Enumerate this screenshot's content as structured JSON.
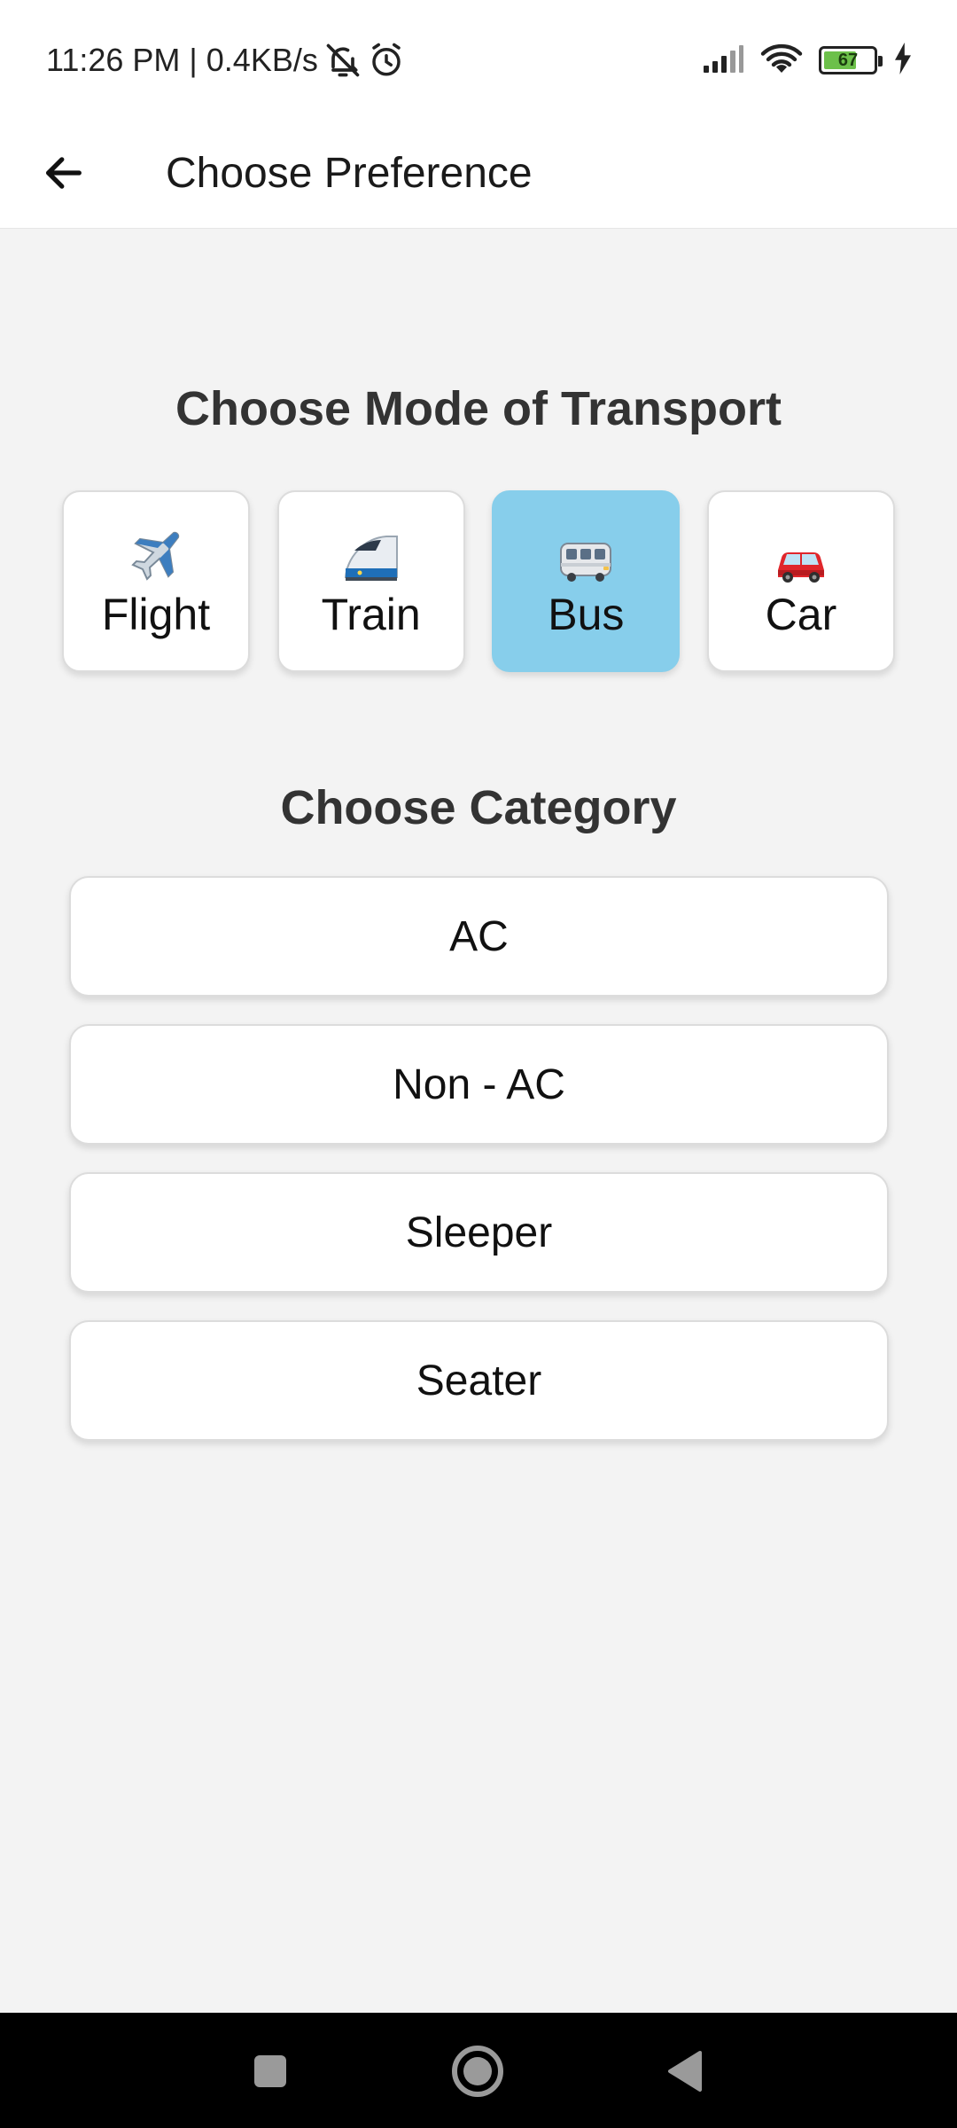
{
  "status_bar": {
    "time_network": "11:26 PM | 0.4KB/s",
    "battery_level": "67",
    "battery_fraction": 0.67,
    "icons": [
      "mute-icon",
      "alarm-icon",
      "signal-icon",
      "wifi-icon",
      "battery-icon",
      "charging-icon"
    ]
  },
  "app_bar": {
    "back_icon": "arrow-left-icon",
    "title": "Choose Preference"
  },
  "transport": {
    "heading": "Choose Mode of Transport",
    "selected": "Bus",
    "selected_color": "#87ceeb",
    "modes": [
      {
        "label": "Flight",
        "icon": "airplane-icon"
      },
      {
        "label": "Train",
        "icon": "bullet-train-icon"
      },
      {
        "label": "Bus",
        "icon": "bus-icon"
      },
      {
        "label": "Car",
        "icon": "car-icon"
      }
    ]
  },
  "category": {
    "heading": "Choose Category",
    "options": [
      "AC",
      "Non - AC",
      "Sleeper",
      "Seater"
    ]
  },
  "nav_bar": {
    "icons": [
      "recents-square-icon",
      "home-circle-icon",
      "back-triangle-icon"
    ]
  }
}
